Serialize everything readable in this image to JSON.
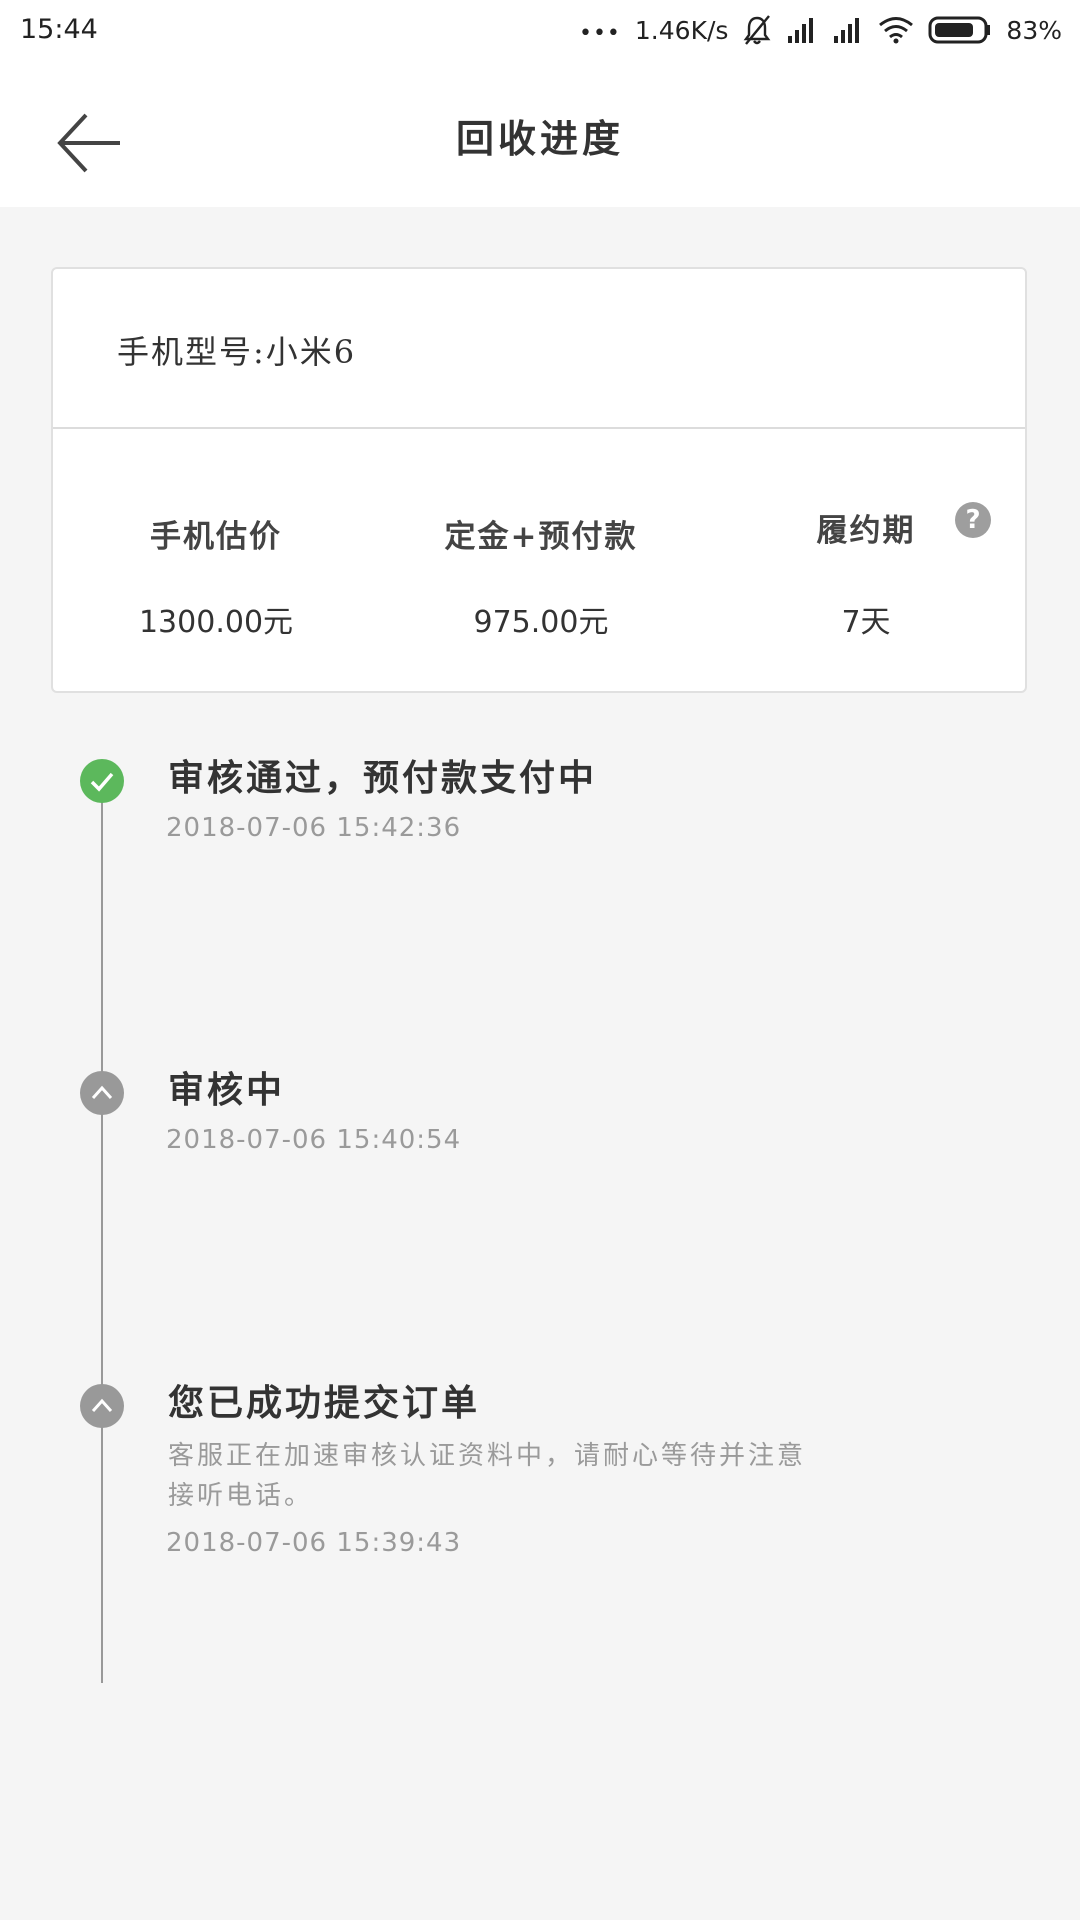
{
  "status_bar": {
    "time": "15:44",
    "dots": "•••",
    "net_speed": "1.46K/s",
    "battery_percent": "83%",
    "battery_level": 0.83
  },
  "header": {
    "title": "回收进度",
    "back_icon": "arrow-left-icon"
  },
  "info_card": {
    "model_label": "手机型号:小米6",
    "stats": [
      {
        "label": "手机估价",
        "value": "1300.00元"
      },
      {
        "label": "定金+预付款",
        "value": "975.00元"
      },
      {
        "label": "履约期",
        "value": "7天"
      }
    ],
    "help_symbol": "?"
  },
  "timeline": [
    {
      "title": "审核通过，预付款支付中",
      "time": "2018-07-06 15:42:36",
      "status": "done",
      "icon": "check-icon"
    },
    {
      "title": "审核中",
      "time": "2018-07-06 15:40:54",
      "status": "pending",
      "icon": "chevron-up-icon"
    },
    {
      "title": "您已成功提交订单",
      "desc": "客服正在加速审核认证资料中，请耐心等待并注意接听电话。",
      "time": "2018-07-06 15:39:43",
      "status": "pending",
      "icon": "chevron-up-icon"
    }
  ],
  "colors": {
    "done": "#5cb85c",
    "pending": "#999999",
    "background": "#f5f5f5"
  }
}
